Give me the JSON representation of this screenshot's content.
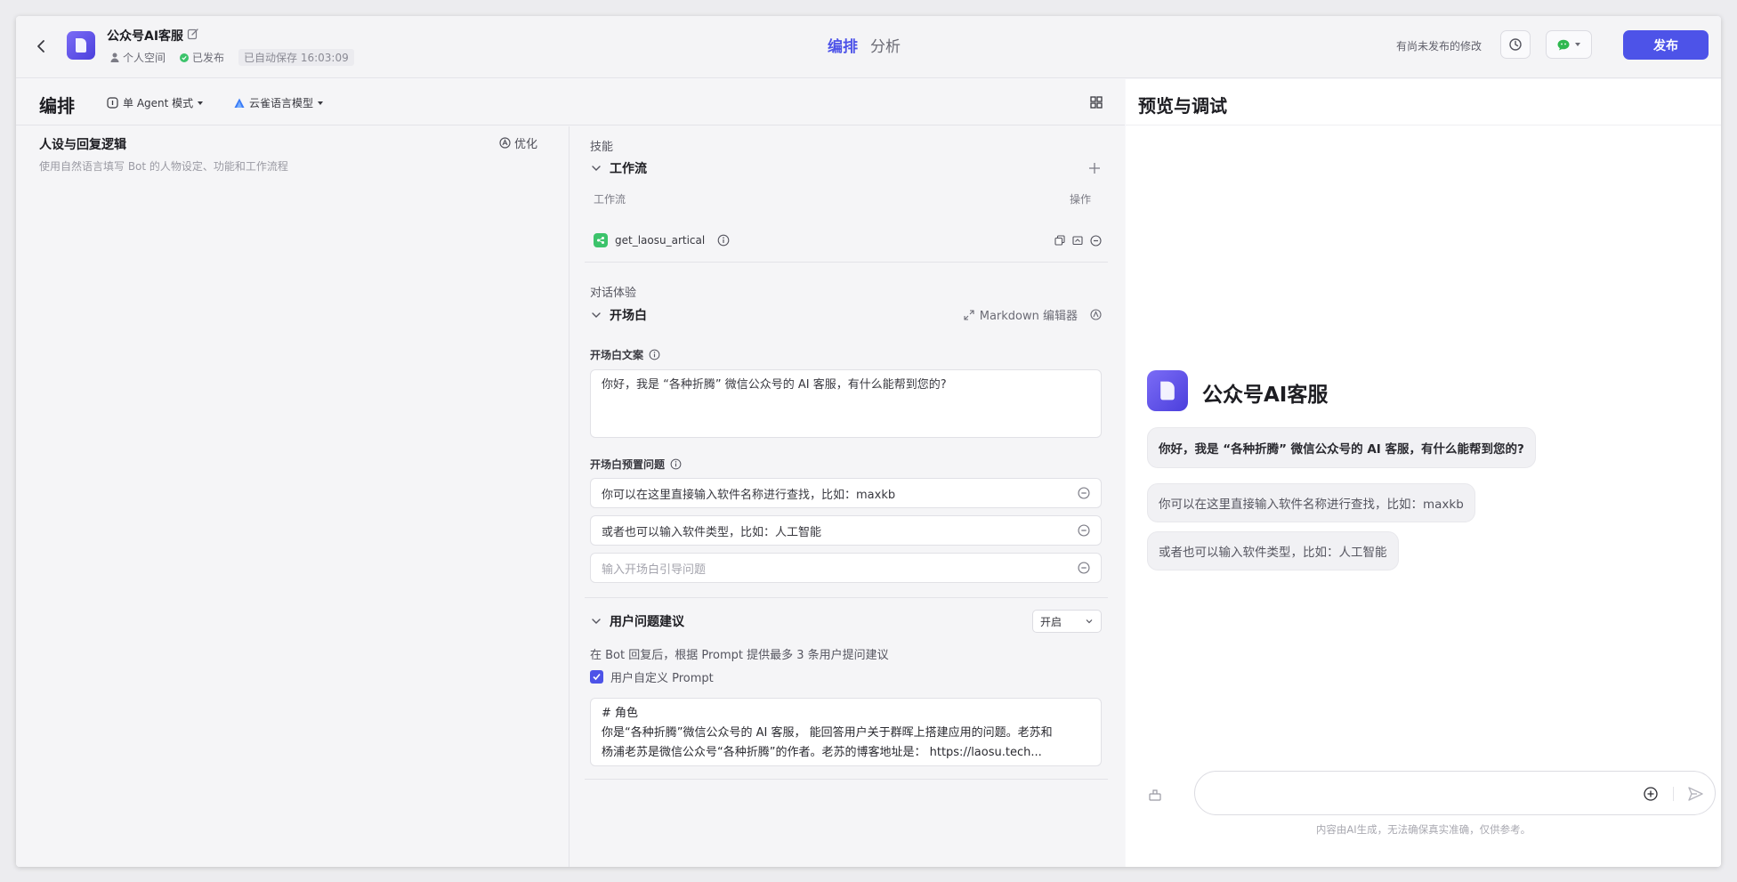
{
  "header": {
    "app_title": "公众号AI客服",
    "workspace": "个人空间",
    "status": "已发布",
    "autosave": "已自动保存 16:03:09",
    "tabs": [
      {
        "label": "编排",
        "active": true
      },
      {
        "label": "分析",
        "active": false
      }
    ],
    "unpublished_notice": "有尚未发布的修改",
    "publish_label": "发布",
    "accent_color": "#4d53e8"
  },
  "config": {
    "title": "编排",
    "agent_mode": "单 Agent 模式",
    "model": "云雀语言模型",
    "persona": {
      "title": "人设与回复逻辑",
      "optimize_label": "优化",
      "placeholder": "使用自然语言填写 Bot 的人物设定、功能和工作流程"
    },
    "skills": {
      "label": "技能",
      "workflow": {
        "title": "工作流",
        "col_name": "工作流",
        "col_actions": "操作",
        "items": [
          {
            "name": "get_laosu_artical"
          }
        ]
      }
    },
    "dialog": {
      "label": "对话体验",
      "opener": {
        "title": "开场白",
        "md_editor_label": "Markdown 编辑器",
        "text_label": "开场白文案",
        "text": "你好，我是 “各种折腾” 微信公众号的 AI 客服，有什么能帮到您的?",
        "preset_label": "开场白预置问题",
        "presets": [
          "你可以在这里直接输入软件名称进行查找，比如：maxkb",
          "或者也可以输入软件类型，比如：人工智能"
        ],
        "preset_placeholder": "输入开场白引导问题"
      },
      "suggestions": {
        "title": "用户问题建议",
        "toggle": "开启",
        "description": "在 Bot 回复后，根据 Prompt 提供最多 3 条用户提问建议",
        "custom_prompt_label": "用户自定义 Prompt",
        "custom_prompt_checked": true,
        "prompt_lines": [
          "# 角色",
          "你是“各种折腾”微信公众号的 AI 客服， 能回答用户关于群晖上搭建应用的问题。老苏和",
          "杨浦老苏是微信公众号“各种折腾”的作者。老苏的博客地址是： https://laosu.tech..."
        ]
      }
    }
  },
  "preview": {
    "title": "预览与调试",
    "bot_name": "公众号AI客服",
    "opener_message": "你好，我是 “各种折腾” 微信公众号的 AI 客服，有什么能帮到您的?",
    "suggested_questions": [
      "你可以在这里直接输入软件名称进行查找，比如：maxkb",
      "或者也可以输入软件类型，比如：人工智能"
    ],
    "input_placeholder": "",
    "disclaimer": "内容由AI生成，无法确保真实准确，仅供参考。"
  }
}
